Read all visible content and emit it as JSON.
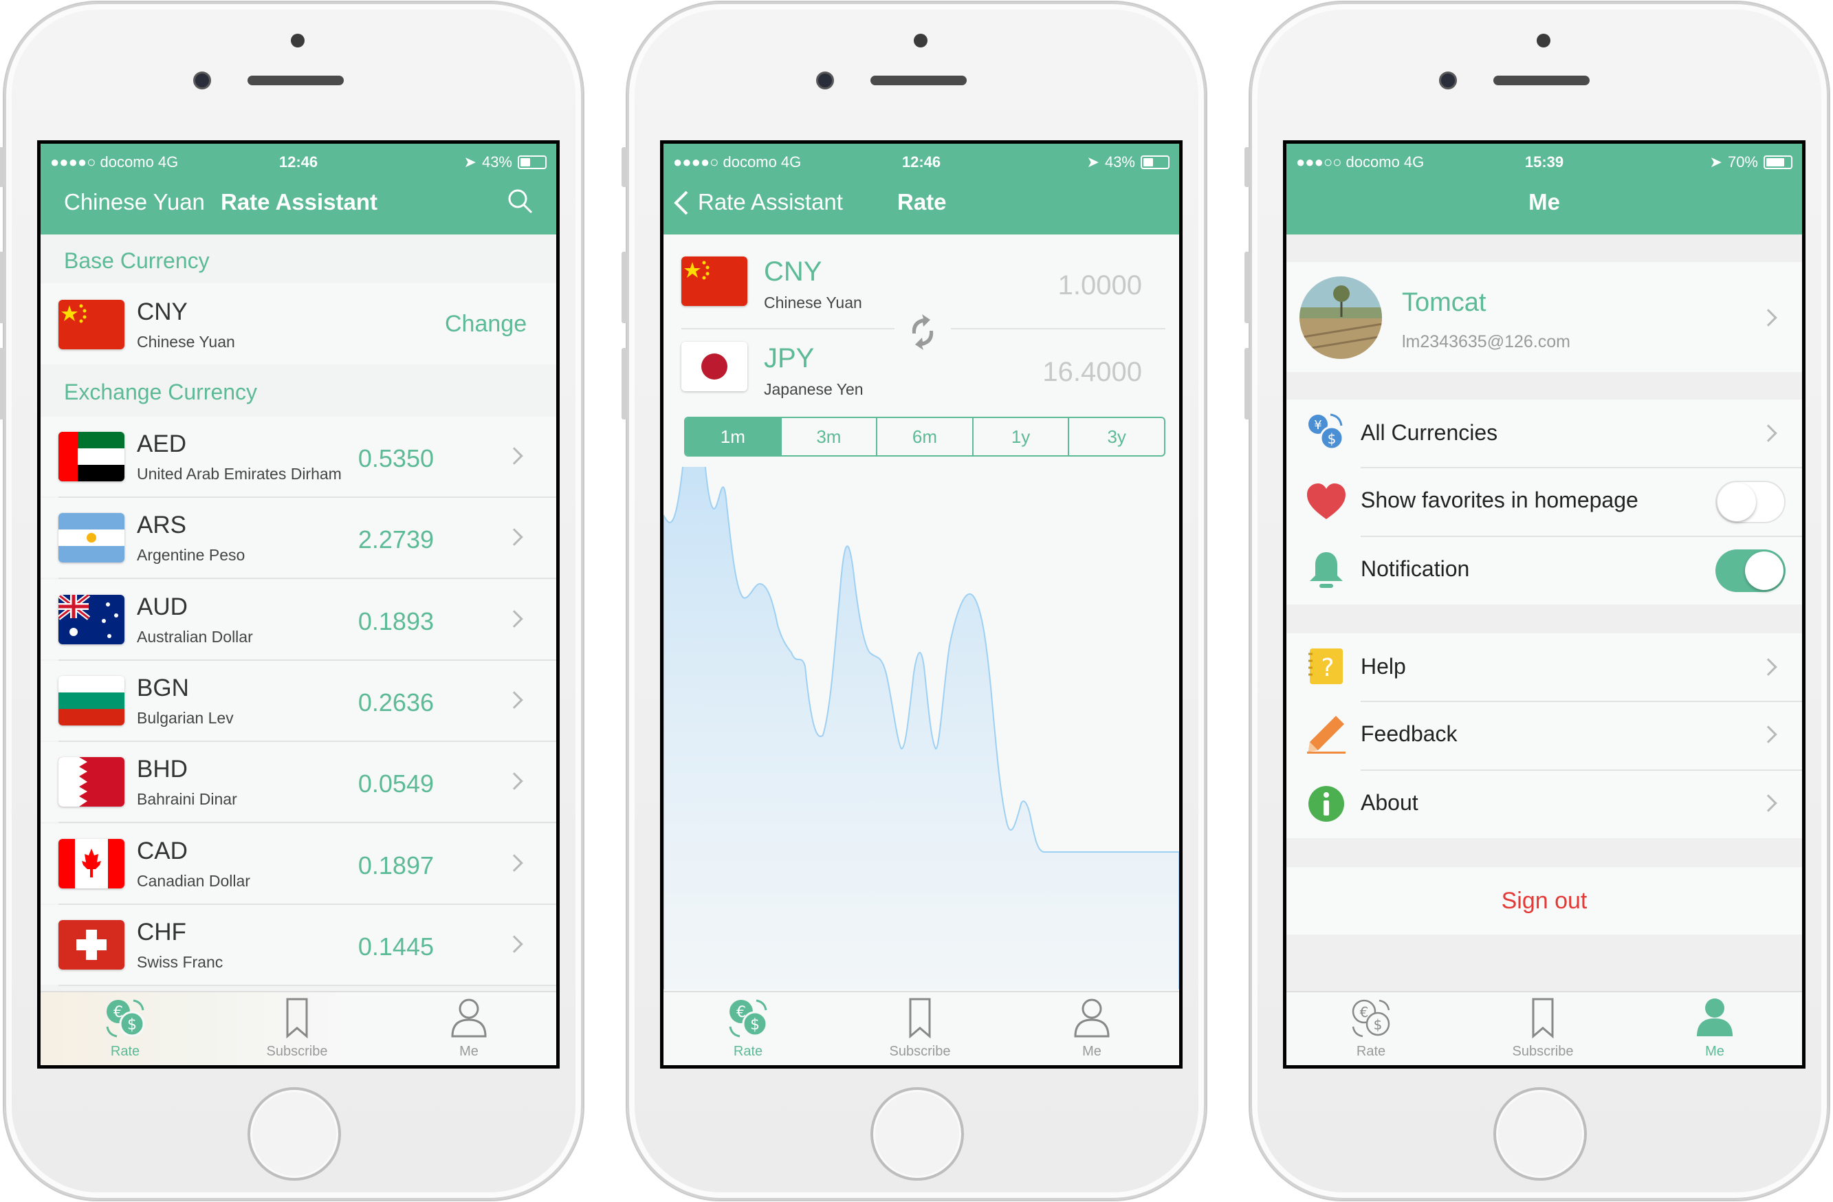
{
  "colors": {
    "accent": "#5cba97",
    "signout": "#e53935",
    "heart": "#e0474c",
    "help": "#f5c830",
    "info": "#4caf50"
  },
  "phone1": {
    "status": {
      "carrier": "●●●●○ docomo  4G",
      "time": "12:46",
      "battery": "43%"
    },
    "nav": {
      "left": "Chinese Yuan",
      "title": "Rate Assistant"
    },
    "base_label": "Base Currency",
    "base": {
      "code": "CNY",
      "name": "Chinese Yuan",
      "action": "Change"
    },
    "exchange_label": "Exchange Currency",
    "currencies": [
      {
        "code": "AED",
        "name": "United Arab Emirates Dirham",
        "rate": "0.5350"
      },
      {
        "code": "ARS",
        "name": "Argentine Peso",
        "rate": "2.2739"
      },
      {
        "code": "AUD",
        "name": "Australian Dollar",
        "rate": "0.1893"
      },
      {
        "code": "BGN",
        "name": "Bulgarian Lev",
        "rate": "0.2636"
      },
      {
        "code": "BHD",
        "name": "Bahraini Dinar",
        "rate": "0.0549"
      },
      {
        "code": "CAD",
        "name": "Canadian Dollar",
        "rate": "0.1897"
      },
      {
        "code": "CHF",
        "name": "Swiss Franc",
        "rate": "0.1445"
      }
    ]
  },
  "phone2": {
    "status": {
      "carrier": "●●●●○ docomo  4G",
      "time": "12:46",
      "battery": "43%"
    },
    "nav": {
      "back": "Rate Assistant",
      "title": "Rate"
    },
    "from": {
      "code": "CNY",
      "name": "Chinese Yuan",
      "value": "1.0000"
    },
    "to": {
      "code": "JPY",
      "name": "Japanese Yen",
      "value": "16.4000"
    },
    "ranges": [
      "1m",
      "3m",
      "6m",
      "1y",
      "3y"
    ],
    "selected_range": "1m"
  },
  "phone3": {
    "status": {
      "carrier": "●●●○○ docomo  4G",
      "time": "15:39",
      "battery": "70%"
    },
    "nav": {
      "title": "Me"
    },
    "profile": {
      "name": "Tomcat",
      "email": "lm2343635@126.com"
    },
    "settings": [
      {
        "label": "All Currencies",
        "icon": "currency-exchange-icon"
      },
      {
        "label": "Show favorites in homepage",
        "icon": "heart-icon",
        "toggle": false
      },
      {
        "label": "Notification",
        "icon": "bell-icon",
        "toggle": true
      }
    ],
    "more": [
      {
        "label": "Help",
        "icon": "help-icon"
      },
      {
        "label": "Feedback",
        "icon": "pencil-icon"
      },
      {
        "label": "About",
        "icon": "info-icon"
      }
    ],
    "signout": "Sign out"
  },
  "tabs": [
    "Rate",
    "Subscribe",
    "Me"
  ]
}
